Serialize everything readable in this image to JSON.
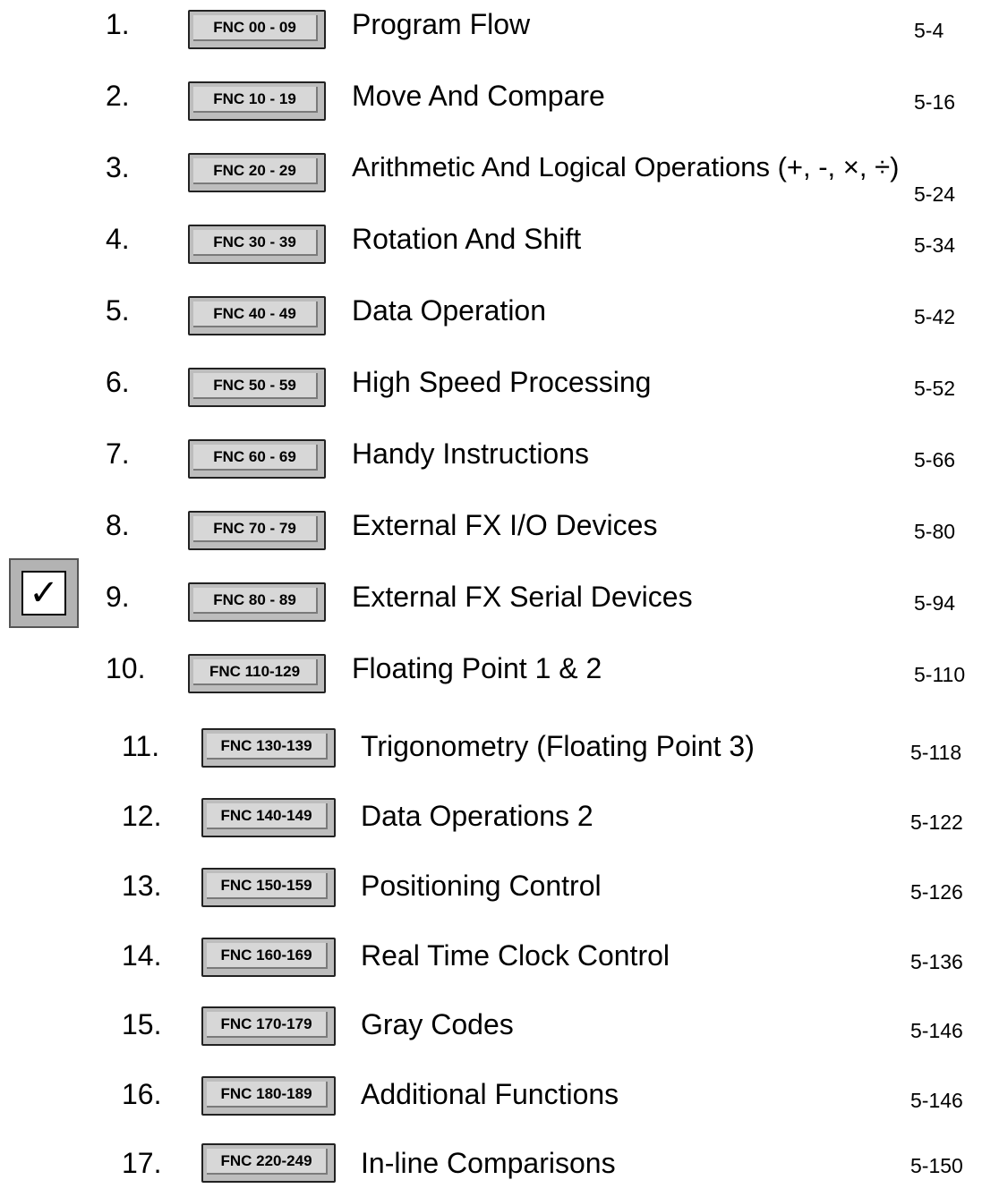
{
  "checkbox": {
    "mark": "✓",
    "checked": true
  },
  "rows": [
    {
      "num": "1.",
      "code": "FNC 00 - 09",
      "title": "Program Flow",
      "page": "5-4"
    },
    {
      "num": "2.",
      "code": "FNC 10 - 19",
      "title": "Move And Compare",
      "page": "5-16"
    },
    {
      "num": "3.",
      "code": "FNC 20 - 29",
      "title": "Arithmetic And Logical Operations (+, -, ×, ÷)",
      "page": "5-24"
    },
    {
      "num": "4.",
      "code": "FNC 30 - 39",
      "title": "Rotation And Shift",
      "page": "5-34"
    },
    {
      "num": "5.",
      "code": "FNC 40 - 49",
      "title": "Data Operation",
      "page": "5-42"
    },
    {
      "num": "6.",
      "code": "FNC 50 - 59",
      "title": "High Speed Processing",
      "page": "5-52"
    },
    {
      "num": "7.",
      "code": "FNC 60 - 69",
      "title": "Handy Instructions",
      "page": "5-66"
    },
    {
      "num": "8.",
      "code": "FNC 70 - 79",
      "title": "External FX I/O Devices",
      "page": "5-80"
    },
    {
      "num": "9.",
      "code": "FNC 80 - 89",
      "title": "External FX Serial Devices",
      "page": "5-94"
    },
    {
      "num": "10.",
      "code": "FNC 110-129",
      "title": "Floating Point 1 & 2",
      "page": "5-110"
    },
    {
      "num": "11.",
      "code": "FNC 130-139",
      "title": "Trigonometry (Floating Point 3)",
      "page": "5-118"
    },
    {
      "num": "12.",
      "code": "FNC 140-149",
      "title": "Data Operations 2",
      "page": "5-122"
    },
    {
      "num": "13.",
      "code": "FNC 150-159",
      "title": "Positioning Control",
      "page": "5-126"
    },
    {
      "num": "14.",
      "code": "FNC 160-169",
      "title": "Real Time Clock Control",
      "page": "5-136"
    },
    {
      "num": "15.",
      "code": "FNC 170-179",
      "title": "Gray Codes",
      "page": "5-146"
    },
    {
      "num": "16.",
      "code": "FNC 180-189",
      "title": "Additional Functions",
      "page": "5-146"
    },
    {
      "num": "17.",
      "code": "FNC 220-249",
      "title": "In-line Comparisons",
      "page": "5-150"
    }
  ]
}
